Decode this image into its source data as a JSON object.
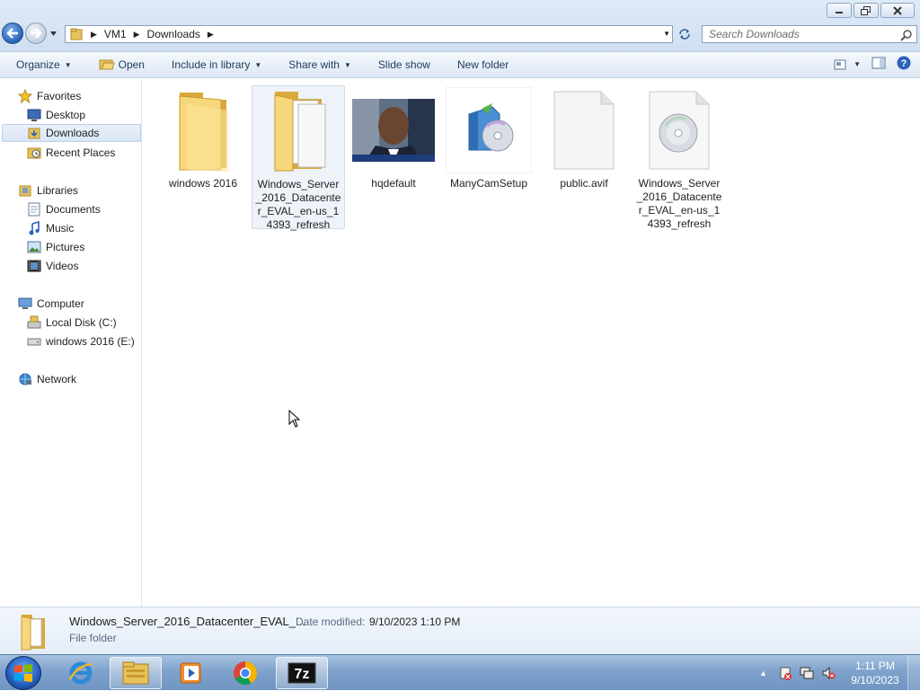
{
  "window": {
    "breadcrumb": [
      "VM1",
      "Downloads"
    ],
    "search_placeholder": "Search Downloads"
  },
  "toolbar": {
    "organize": "Organize",
    "open": "Open",
    "include_in_library": "Include in library",
    "share_with": "Share with",
    "slide_show": "Slide show",
    "new_folder": "New folder"
  },
  "nav": {
    "favorites": "Favorites",
    "desktop": "Desktop",
    "downloads": "Downloads",
    "recent_places": "Recent Places",
    "libraries": "Libraries",
    "documents": "Documents",
    "music": "Music",
    "pictures": "Pictures",
    "videos": "Videos",
    "computer": "Computer",
    "local_disk": "Local Disk (C:)",
    "windows_drive": "windows 2016 (E:)",
    "network": "Network"
  },
  "files": [
    {
      "label": "windows 2016",
      "icon": "folder-icon"
    },
    {
      "label": "Windows_Server_2016_Datacenter_EVAL_en-us_14393_refresh",
      "icon": "folder-with-files-icon",
      "selected": true
    },
    {
      "label": "hqdefault",
      "icon": "photo-thumbnail"
    },
    {
      "label": "ManyCamSetup",
      "icon": "installer-icon"
    },
    {
      "label": "public.avif",
      "icon": "blank-file-icon"
    },
    {
      "label": "Windows_Server_2016_Datacenter_EVAL_en-us_14393_refresh",
      "icon": "disc-image-icon"
    }
  ],
  "details": {
    "name": "Windows_Server_2016_Datacenter_EVAL_...",
    "date_label": "Date modified:",
    "date_value": "9/10/2023 1:10 PM",
    "type": "File folder"
  },
  "taskbar": {
    "time": "1:11 PM",
    "date": "9/10/2023",
    "apps": [
      "internet-explorer-icon",
      "file-explorer-icon",
      "media-player-icon",
      "chrome-icon",
      "7zip-icon"
    ]
  },
  "colors": {
    "accent": "#1e395b",
    "selection": "#d9e6f6",
    "taskbar": "#7fa2cc"
  }
}
